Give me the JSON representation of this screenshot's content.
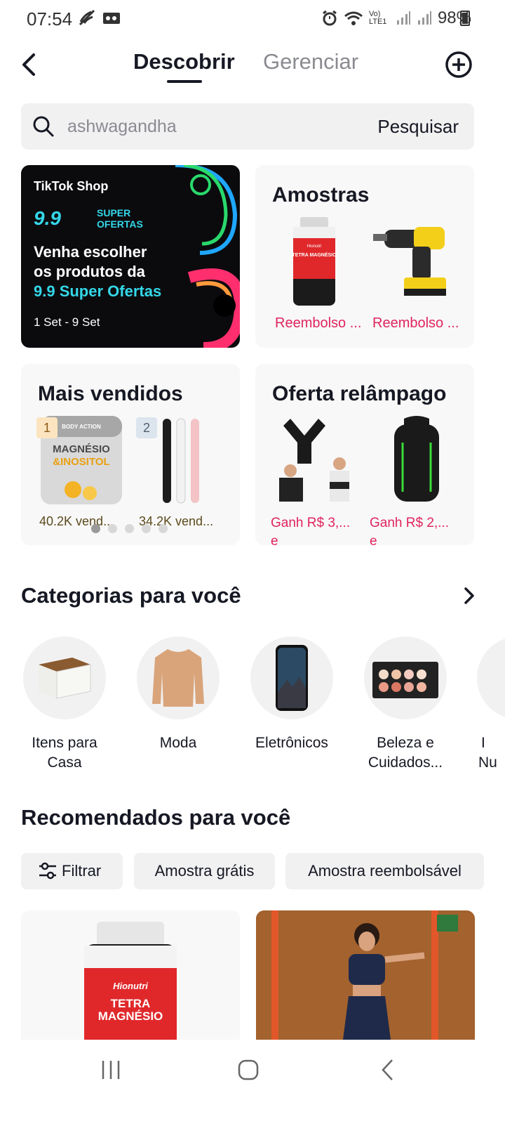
{
  "status_bar": {
    "time": "07:54",
    "battery": "98%",
    "network": "Vo) LTE1"
  },
  "header": {
    "tab_active": "Descobrir",
    "tab_inactive": "Gerenciar"
  },
  "search": {
    "placeholder": "ashwagandha",
    "button": "Pesquisar"
  },
  "promo_banner": {
    "logo": "TikTok Shop",
    "badge_number": "9.9",
    "badge_text": "SUPER OFERTAS",
    "headline_1": "Venha escolher",
    "headline_2": "os produtos da",
    "headline_3": "9.9 Super Ofertas",
    "dates": "1 Set - 9 Set"
  },
  "amostras": {
    "title": "Amostras",
    "items": [
      {
        "label": "Reembolso ...",
        "product_text": "TETRA MAGNÉSIO",
        "brand": "Hionutri"
      },
      {
        "label": "Reembolso ..."
      }
    ]
  },
  "mais_vendidos": {
    "title": "Mais vendidos",
    "items": [
      {
        "rank": "1",
        "sold": "40.2K vend...",
        "product_text_1": "MAGNÉSIO",
        "product_text_2": "&INOSITOL",
        "brand": "BODY ACTION"
      },
      {
        "rank": "2",
        "sold": "34.2K vend..."
      }
    ]
  },
  "oferta_relampago": {
    "title": "Oferta relâmpago",
    "items": [
      {
        "line1": "Ganh  R$ 3,...",
        "line2": "e"
      },
      {
        "line1": "Ganh  R$ 2,...",
        "line2": "e"
      }
    ]
  },
  "categorias": {
    "title": "Categorias para você",
    "items": [
      {
        "line1": "Itens para",
        "line2": "Casa"
      },
      {
        "line1": "Moda",
        "line2": ""
      },
      {
        "line1": "Eletrônicos",
        "line2": ""
      },
      {
        "line1": "Beleza e",
        "line2": "Cuidados..."
      },
      {
        "line1": "I",
        "line2": "Nu"
      }
    ]
  },
  "recomendados": {
    "title": "Recomendados para você",
    "chips": [
      "Filtrar",
      "Amostra grátis",
      "Amostra reembolsável"
    ],
    "card1": {
      "brand": "Hionutri",
      "product_line1": "TETRA",
      "product_line2": "MAGNÉSIO"
    }
  },
  "colors": {
    "accent_pink": "#e0245e",
    "cyan": "#34d7e8",
    "bg_gray": "#f1f1f2"
  }
}
